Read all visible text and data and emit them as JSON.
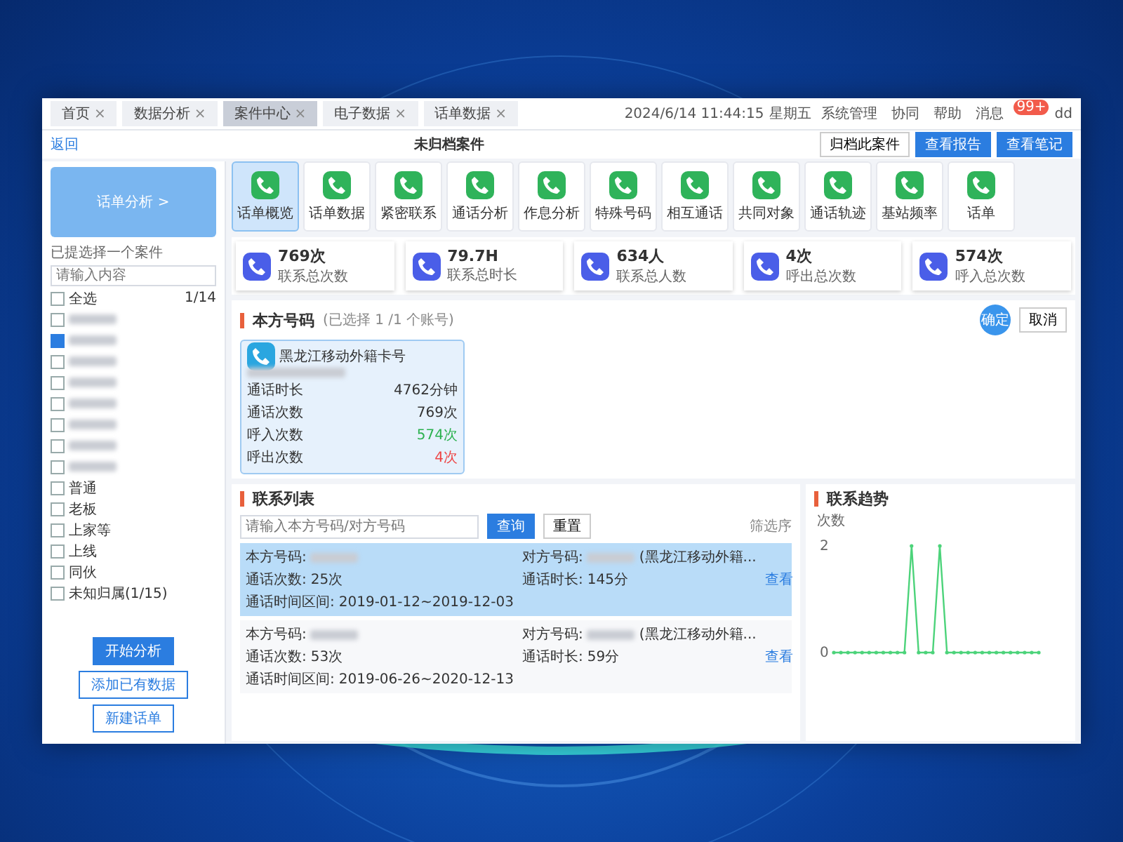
{
  "tabs": [
    {
      "label": "首页",
      "close": "×",
      "selected": false
    },
    {
      "label": "数据分析",
      "close": "×",
      "selected": false
    },
    {
      "label": "案件中心",
      "close": "×",
      "selected": true
    },
    {
      "label": "电子数据",
      "close": "×",
      "selected": false
    },
    {
      "label": "话单数据",
      "close": "×",
      "selected": false
    }
  ],
  "header": {
    "datetime": "2024/6/14 11:44:15",
    "weekday": "星期五",
    "links": [
      "系统管理",
      "协同",
      "帮助",
      "消息"
    ],
    "badge": "99+",
    "user": "dd"
  },
  "subbar": {
    "back": "返回",
    "title": "未归档案件",
    "buttons": [
      "归档此案件",
      "查看报告",
      "查看笔记"
    ]
  },
  "module": {
    "label": "话单分析 >"
  },
  "tiles": [
    {
      "label": "话单概览",
      "selected": true
    },
    {
      "label": "话单数据",
      "selected": false
    },
    {
      "label": "紧密联系",
      "selected": false
    },
    {
      "label": "通话分析",
      "selected": false
    },
    {
      "label": "作息分析",
      "selected": false
    },
    {
      "label": "特殊号码",
      "selected": false
    },
    {
      "label": "相互通话",
      "selected": false
    },
    {
      "label": "共同对象",
      "selected": false
    },
    {
      "label": "通话轨迹",
      "selected": false
    },
    {
      "label": "基站频率",
      "selected": false
    },
    {
      "label": "话单",
      "selected": false
    }
  ],
  "sidebar": {
    "hint": "已提选择一个案件",
    "search_placeholder": "请输入内容",
    "select_all": "全选",
    "select_all_checked": false,
    "count": "1/14",
    "items": [
      {
        "kind": "redacted",
        "checked": false
      },
      {
        "kind": "redacted",
        "checked": true
      },
      {
        "kind": "redacted",
        "checked": false
      },
      {
        "kind": "redacted",
        "checked": false
      },
      {
        "kind": "redacted",
        "checked": false
      },
      {
        "kind": "redacted",
        "checked": false
      },
      {
        "kind": "redacted",
        "checked": false
      },
      {
        "kind": "redacted",
        "checked": false
      },
      {
        "kind": "label",
        "text": "普通",
        "checked": false
      },
      {
        "kind": "label",
        "text": "老板",
        "checked": false
      },
      {
        "kind": "label",
        "text": "上家等",
        "checked": false
      },
      {
        "kind": "label",
        "text": "上线",
        "checked": false
      },
      {
        "kind": "label",
        "text": "同伙",
        "checked": false
      },
      {
        "kind": "label",
        "text": "未知归属(1/15)",
        "checked": false
      }
    ],
    "buttons": [
      "开始分析",
      "添加已有数据",
      "新建话单"
    ]
  },
  "stats": [
    {
      "value": "769次",
      "label": "联系总次数"
    },
    {
      "value": "79.7H",
      "label": "联系总时长"
    },
    {
      "value": "634人",
      "label": "联系总人数"
    },
    {
      "value": "4次",
      "label": "呼出总次数"
    },
    {
      "value": "574次",
      "label": "呼入总次数"
    }
  ],
  "own_numbers": {
    "title": "本方号码",
    "selection": "(已选择 1 /1 个账号)",
    "confirm": "确定",
    "cancel": "取消",
    "card": {
      "carrier": "黑龙江移动外籍卡号",
      "rows": [
        {
          "label": "通话时长",
          "value": "4762分钟",
          "color": "#333333"
        },
        {
          "label": "通话次数",
          "value": "769次",
          "color": "#333333"
        },
        {
          "label": "呼入次数",
          "value": "574次",
          "color": "#2bb14e"
        },
        {
          "label": "呼出次数",
          "value": "4次",
          "color": "#ee4444"
        }
      ]
    }
  },
  "contacts": {
    "title": "联系列表",
    "search_placeholder": "请输入本方号码/对方号码",
    "query": "查询",
    "reset": "重置",
    "filter": "筛选序",
    "rows": [
      {
        "selected": true,
        "own_label": "本方号码:",
        "other_label": "对方号码:",
        "other_region": "(黑龙江移动外籍...",
        "count_label": "通话次数:",
        "count": "25次",
        "duration_label": "通话时长:",
        "duration": "145分",
        "range_label": "通话时间区间:",
        "range": "2019-01-12~2019-12-03",
        "action": "查看"
      },
      {
        "selected": false,
        "own_label": "本方号码:",
        "other_label": "对方号码:",
        "other_region": "(黑龙江移动外籍...",
        "count_label": "通话次数:",
        "count": "53次",
        "duration_label": "通话时长:",
        "duration": "59分",
        "range_label": "通话时间区间:",
        "range": "2019-06-26~2020-12-13",
        "action": "查看"
      }
    ]
  },
  "trend": {
    "title": "联系趋势",
    "chart_data": {
      "type": "line",
      "ylabel": "次数",
      "ylim": [
        0,
        2
      ],
      "yticks": [
        0,
        2
      ],
      "series": [
        {
          "color": "#4cd37a",
          "values": [
            0,
            0,
            0,
            0,
            0,
            0,
            0,
            0,
            0,
            0,
            0,
            2,
            0,
            0,
            0,
            2,
            0,
            0,
            0,
            0,
            0,
            0,
            0,
            0,
            0,
            0,
            0,
            0,
            0,
            0
          ]
        }
      ]
    }
  }
}
